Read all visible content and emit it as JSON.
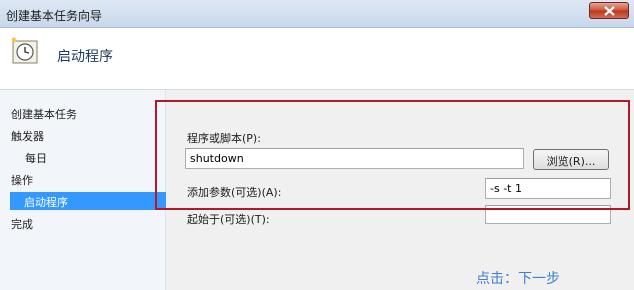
{
  "window": {
    "title": "创建基本任务向导"
  },
  "header": {
    "heading": "启动程序"
  },
  "sidebar": {
    "items": [
      {
        "label": "创建基本任务"
      },
      {
        "label": "触发器"
      },
      {
        "label": "每日"
      },
      {
        "label": "操作"
      },
      {
        "label": "启动程序"
      },
      {
        "label": "完成"
      }
    ]
  },
  "form": {
    "program_label": "程序或脚本(P):",
    "program_value": "shutdown",
    "browse_label": "浏览(R)...",
    "args_label": "添加参数(可选)(A):",
    "args_value": "-s -t 1",
    "startin_label": "起始于(可选)(T):",
    "startin_value": ""
  },
  "annotation": {
    "note": "点击：下一步",
    "highlight_color": "#b2182b"
  },
  "icons": {
    "close": "close-icon",
    "wizard": "clock-wizard-icon"
  }
}
